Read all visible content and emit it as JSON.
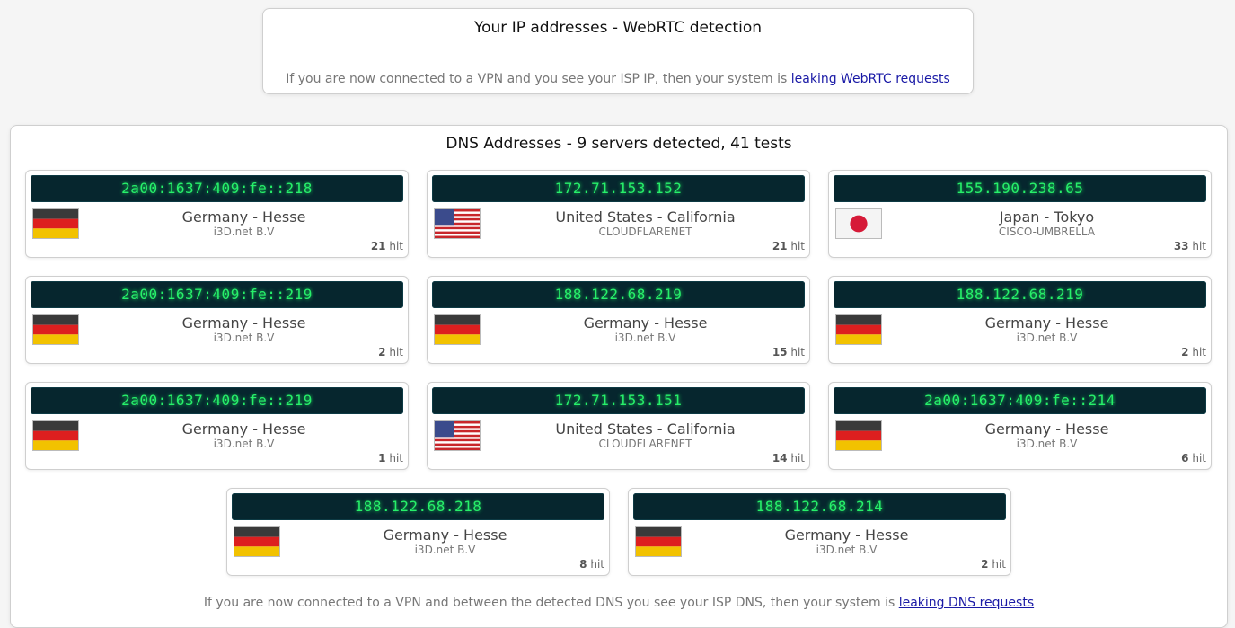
{
  "webrtc": {
    "title": "Your IP addresses - WebRTC detection",
    "note_prefix": "If you are now connected to a VPN and you see your ISP IP, then your system is ",
    "note_link": "leaking WebRTC requests"
  },
  "dns": {
    "title": "DNS Addresses - 9 servers detected, 41 tests",
    "footer_prefix": "If you are now connected to a VPN and between the detected DNS you see your ISP DNS, then your system is ",
    "footer_link": "leaking DNS requests",
    "servers": [
      {
        "ip": "2a00:1637:409:fe::218",
        "location": "Germany - Hesse",
        "isp": "i3D.net B.V",
        "hits": "21",
        "hit_unit": "hit",
        "flag": "germany-flag-icon"
      },
      {
        "ip": "172.71.153.152",
        "location": "United States - California",
        "isp": "CLOUDFLARENET",
        "hits": "21",
        "hit_unit": "hit",
        "flag": "usa-flag-icon"
      },
      {
        "ip": "155.190.238.65",
        "location": "Japan - Tokyo",
        "isp": "CISCO-UMBRELLA",
        "hits": "33",
        "hit_unit": "hit",
        "flag": "japan-flag-icon"
      },
      {
        "ip": "2a00:1637:409:fe::219",
        "location": "Germany - Hesse",
        "isp": "i3D.net B.V",
        "hits": "2",
        "hit_unit": "hit",
        "flag": "germany-flag-icon"
      },
      {
        "ip": "188.122.68.219",
        "location": "Germany - Hesse",
        "isp": "i3D.net B.V",
        "hits": "15",
        "hit_unit": "hit",
        "flag": "germany-flag-icon"
      },
      {
        "ip": "188.122.68.219",
        "location": "Germany - Hesse",
        "isp": "i3D.net B.V",
        "hits": "2",
        "hit_unit": "hit",
        "flag": "germany-flag-icon"
      },
      {
        "ip": "2a00:1637:409:fe::219",
        "location": "Germany - Hesse",
        "isp": "i3D.net B.V",
        "hits": "1",
        "hit_unit": "hit",
        "flag": "germany-flag-icon"
      },
      {
        "ip": "172.71.153.151",
        "location": "United States - California",
        "isp": "CLOUDFLARENET",
        "hits": "14",
        "hit_unit": "hit",
        "flag": "usa-flag-icon"
      },
      {
        "ip": "2a00:1637:409:fe::214",
        "location": "Germany - Hesse",
        "isp": "i3D.net B.V",
        "hits": "6",
        "hit_unit": "hit",
        "flag": "germany-flag-icon"
      },
      {
        "ip": "188.122.68.218",
        "location": "Germany - Hesse",
        "isp": "i3D.net B.V",
        "hits": "8",
        "hit_unit": "hit",
        "flag": "germany-flag-icon"
      },
      {
        "ip": "188.122.68.214",
        "location": "Germany - Hesse",
        "isp": "i3D.net B.V",
        "hits": "2",
        "hit_unit": "hit",
        "flag": "germany-flag-icon"
      }
    ]
  },
  "colors": {
    "ip_bar_bg": "#06262e",
    "ip_text": "#27f06a",
    "link": "#1a1aa6"
  }
}
